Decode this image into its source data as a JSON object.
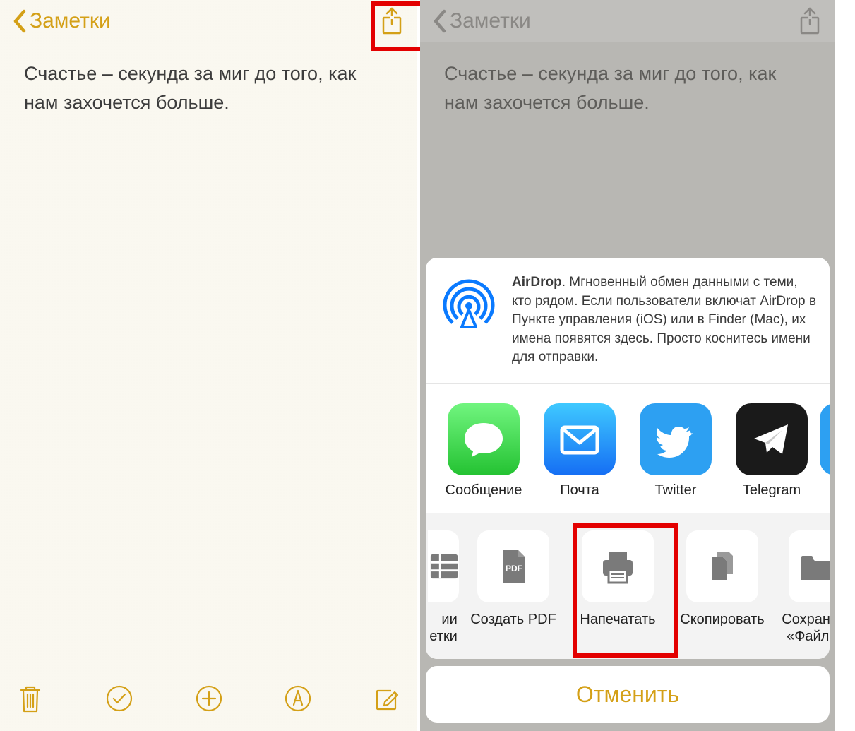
{
  "colors": {
    "accent": "#d4a017",
    "highlight": "#e30000",
    "grey": "#7a7a7a"
  },
  "left": {
    "back_label": "Заметки",
    "note_text": "Счастье – секунда за миг до того, как нам захочется больше.",
    "toolbar": {
      "trash": "trash-icon",
      "check": "checkmark-circle-icon",
      "add": "plus-circle-icon",
      "draw": "markup-icon",
      "compose": "compose-icon"
    }
  },
  "right": {
    "back_label": "Заметки",
    "note_text": "Счастье – секунда за миг до того, как нам захочется больше.",
    "share_sheet": {
      "airdrop": {
        "title": "AirDrop",
        "description": ". Мгновенный обмен данными с теми, кто рядом. Если пользователи включат AirDrop в Пункте управления (iOS) или в Finder (Mac), их имена появятся здесь. Просто коснитесь имени для отправки."
      },
      "apps": [
        {
          "label": "Сообщение",
          "color": "#43d65b",
          "icon": "message-icon"
        },
        {
          "label": "Почта",
          "color": "#2da0f2",
          "icon": "mail-icon"
        },
        {
          "label": "Twitter",
          "color": "#2da0f2",
          "icon": "twitter-icon"
        },
        {
          "label": "Telegram",
          "color": "#1a1a1a",
          "icon": "telegram-icon"
        }
      ],
      "actions_partial_first": {
        "label": "ии\nетки",
        "icon": "table-icon"
      },
      "actions": [
        {
          "label": "Создать PDF",
          "icon": "pdf-icon"
        },
        {
          "label": "Напечатать",
          "icon": "printer-icon",
          "highlight": true
        },
        {
          "label": "Скопировать",
          "icon": "copy-icon"
        },
        {
          "label": "Сохранить\n«Файлы»",
          "icon": "folder-icon"
        }
      ],
      "cancel": "Отменить"
    }
  }
}
